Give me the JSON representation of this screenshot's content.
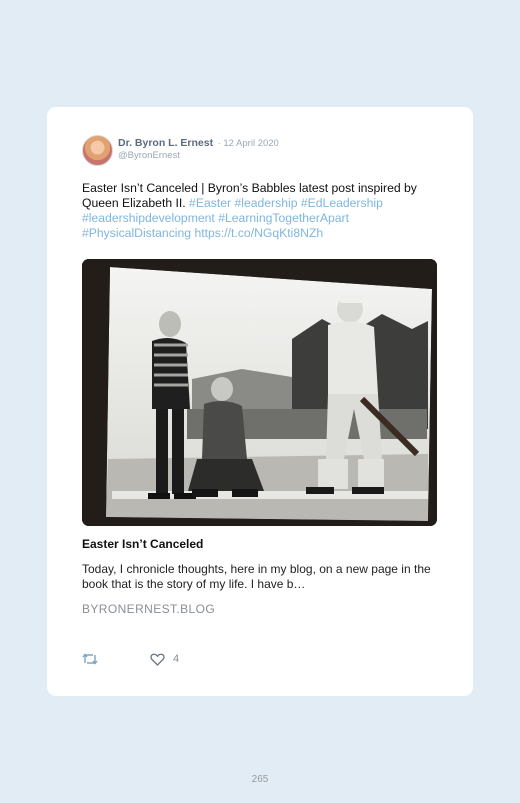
{
  "tweet": {
    "author_name": "Dr. Byron L. Ernest",
    "date": "· 12 April 2020",
    "handle": "@ByronErnest",
    "text_plain": "Easter Isn’t Canceled | Byron’s Babbles latest post inspired by Queen Elizabeth II. ",
    "hashtags": {
      "easter": "#Easter",
      "leadership": "#leadership",
      "edleadership": "#EdLeadership",
      "leadershipdevelopment": "#leadershipdevelopment",
      "learningtogetherapart": "#LearningTogetherApart",
      "physicaldistancing": "#PhysicalDistancing"
    },
    "link": "https://t.co/NGqKti8NZh"
  },
  "card": {
    "title": "Easter Isn’t Canceled",
    "description": "Today, I chronicle thoughts, here in my blog, on a new page in the book that is the story of my life. I have b…",
    "domain": "BYRONERNEST.BLOG"
  },
  "actions": {
    "like_count": "4",
    "icons": [
      "retweet-icon",
      "heart-icon"
    ]
  },
  "page_number": "265",
  "colors": {
    "background": "#e1ecf4",
    "link": "#7fb6e0",
    "muted": "#8a8f96"
  }
}
